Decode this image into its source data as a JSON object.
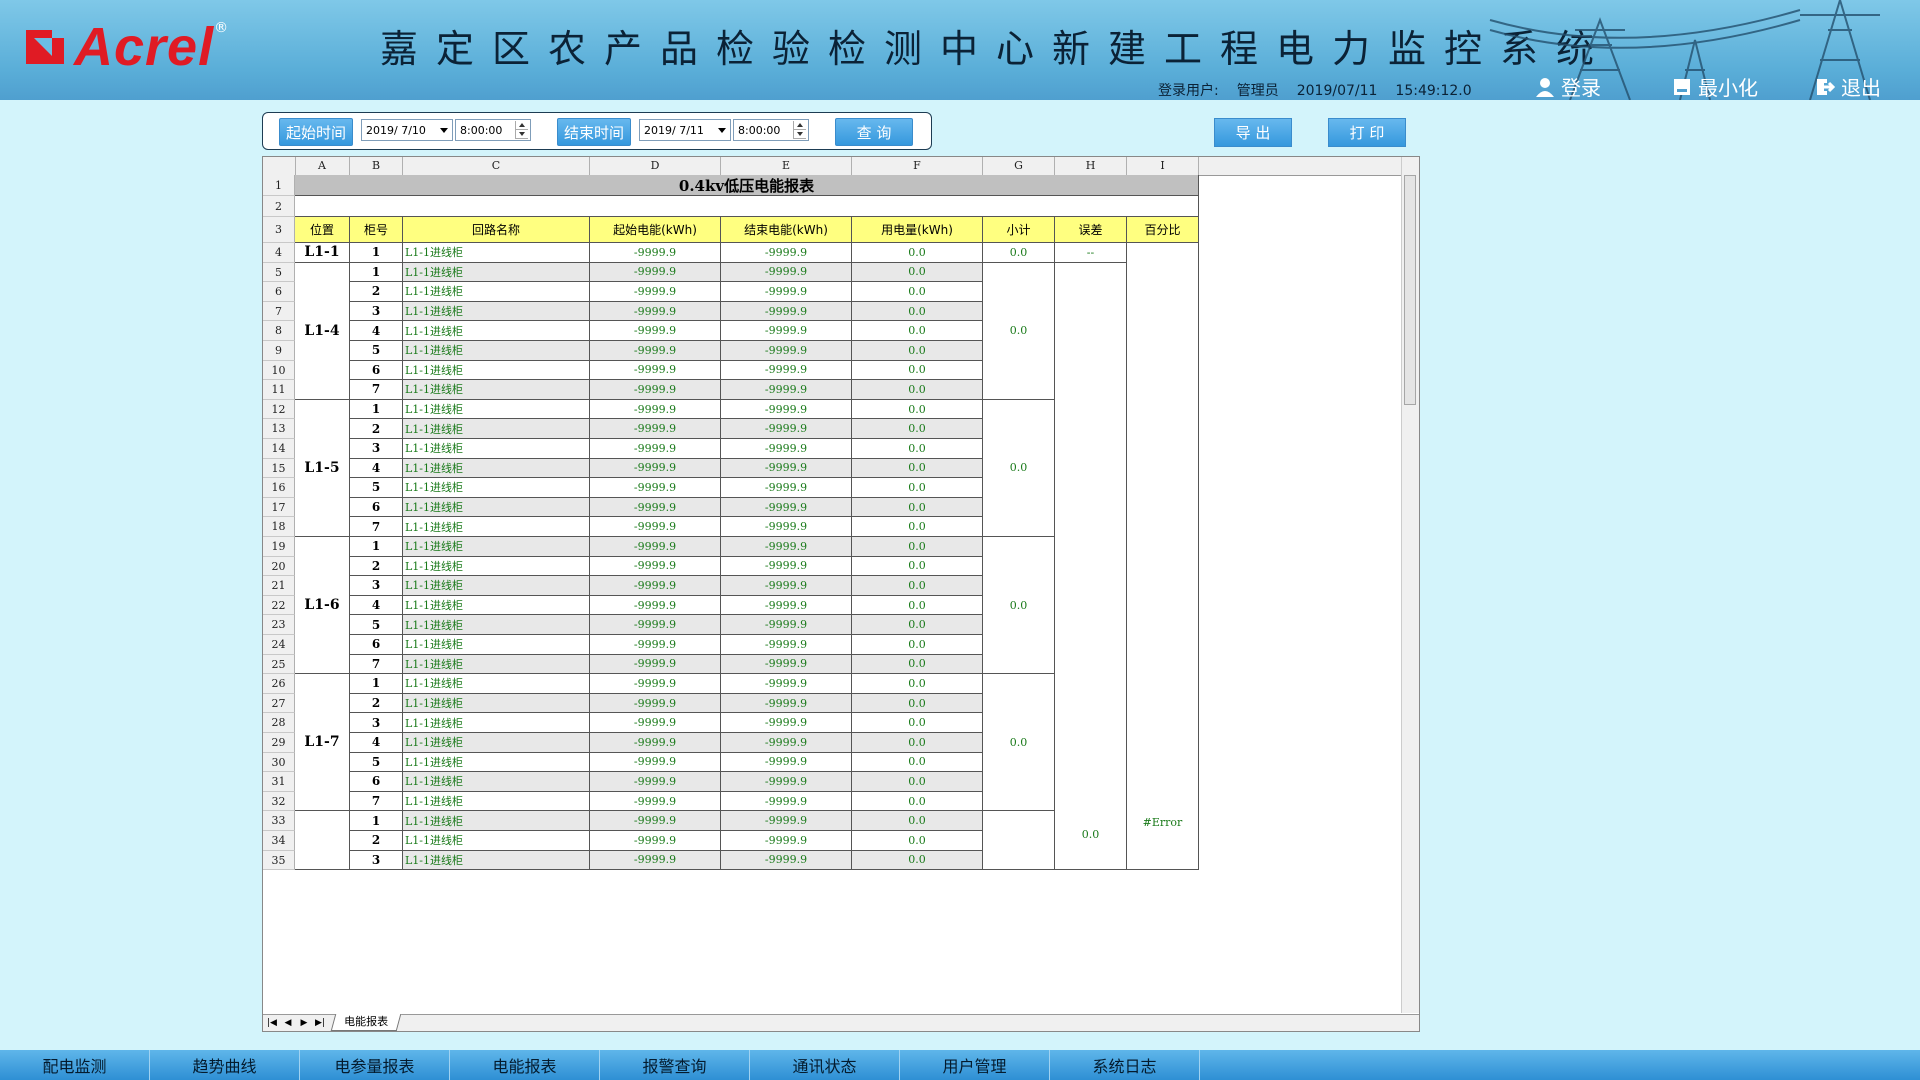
{
  "header": {
    "logo_text": "Acrel",
    "logo_reg": "®",
    "title": "嘉定区农产品检验检测中心新建工程电力监控系统",
    "login_label": "登录用户:",
    "user": "管理员",
    "date": "2019/07/11",
    "time": "15:49:12.0",
    "buttons": {
      "login": "登录",
      "minimize": "最小化",
      "exit": "退出"
    }
  },
  "toolbar": {
    "start_label": "起始时间",
    "start_date": "2019/ 7/10",
    "start_time": "8:00:00",
    "end_label": "结束时间",
    "end_date": "2019/ 7/11",
    "end_time": "8:00:00",
    "query": "查 询",
    "export": "导 出",
    "print": "打 印"
  },
  "sheet": {
    "columns": [
      "A",
      "B",
      "C",
      "D",
      "E",
      "F",
      "G",
      "H",
      "I"
    ],
    "title": "0.4kv低压电能报表",
    "headers": [
      "位置",
      "柜号",
      "回路名称",
      "起始电能(kWh)",
      "结束电能(kWh)",
      "用电量(kWh)",
      "小计",
      "误差",
      "百分比"
    ],
    "groups": [
      {
        "pos": "L1-1",
        "subtotal": "0.0",
        "rows": [
          {
            "no": "1",
            "name": "L1-1进线柜",
            "start": "-9999.9",
            "end": "-9999.9",
            "use": "0.0"
          }
        ]
      },
      {
        "pos": "L1-4",
        "subtotal": "0.0",
        "rows": [
          {
            "no": "1",
            "name": "L1-1进线柜",
            "start": "-9999.9",
            "end": "-9999.9",
            "use": "0.0"
          },
          {
            "no": "2",
            "name": "L1-1进线柜",
            "start": "-9999.9",
            "end": "-9999.9",
            "use": "0.0"
          },
          {
            "no": "3",
            "name": "L1-1进线柜",
            "start": "-9999.9",
            "end": "-9999.9",
            "use": "0.0"
          },
          {
            "no": "4",
            "name": "L1-1进线柜",
            "start": "-9999.9",
            "end": "-9999.9",
            "use": "0.0"
          },
          {
            "no": "5",
            "name": "L1-1进线柜",
            "start": "-9999.9",
            "end": "-9999.9",
            "use": "0.0"
          },
          {
            "no": "6",
            "name": "L1-1进线柜",
            "start": "-9999.9",
            "end": "-9999.9",
            "use": "0.0"
          },
          {
            "no": "7",
            "name": "L1-1进线柜",
            "start": "-9999.9",
            "end": "-9999.9",
            "use": "0.0"
          }
        ]
      },
      {
        "pos": "L1-5",
        "subtotal": "0.0",
        "rows": [
          {
            "no": "1",
            "name": "L1-1进线柜",
            "start": "-9999.9",
            "end": "-9999.9",
            "use": "0.0"
          },
          {
            "no": "2",
            "name": "L1-1进线柜",
            "start": "-9999.9",
            "end": "-9999.9",
            "use": "0.0"
          },
          {
            "no": "3",
            "name": "L1-1进线柜",
            "start": "-9999.9",
            "end": "-9999.9",
            "use": "0.0"
          },
          {
            "no": "4",
            "name": "L1-1进线柜",
            "start": "-9999.9",
            "end": "-9999.9",
            "use": "0.0"
          },
          {
            "no": "5",
            "name": "L1-1进线柜",
            "start": "-9999.9",
            "end": "-9999.9",
            "use": "0.0"
          },
          {
            "no": "6",
            "name": "L1-1进线柜",
            "start": "-9999.9",
            "end": "-9999.9",
            "use": "0.0"
          },
          {
            "no": "7",
            "name": "L1-1进线柜",
            "start": "-9999.9",
            "end": "-9999.9",
            "use": "0.0"
          }
        ]
      },
      {
        "pos": "L1-6",
        "subtotal": "0.0",
        "rows": [
          {
            "no": "1",
            "name": "L1-1进线柜",
            "start": "-9999.9",
            "end": "-9999.9",
            "use": "0.0"
          },
          {
            "no": "2",
            "name": "L1-1进线柜",
            "start": "-9999.9",
            "end": "-9999.9",
            "use": "0.0"
          },
          {
            "no": "3",
            "name": "L1-1进线柜",
            "start": "-9999.9",
            "end": "-9999.9",
            "use": "0.0"
          },
          {
            "no": "4",
            "name": "L1-1进线柜",
            "start": "-9999.9",
            "end": "-9999.9",
            "use": "0.0"
          },
          {
            "no": "5",
            "name": "L1-1进线柜",
            "start": "-9999.9",
            "end": "-9999.9",
            "use": "0.0"
          },
          {
            "no": "6",
            "name": "L1-1进线柜",
            "start": "-9999.9",
            "end": "-9999.9",
            "use": "0.0"
          },
          {
            "no": "7",
            "name": "L1-1进线柜",
            "start": "-9999.9",
            "end": "-9999.9",
            "use": "0.0"
          }
        ]
      },
      {
        "pos": "L1-7",
        "subtotal": "0.0",
        "rows": [
          {
            "no": "1",
            "name": "L1-1进线柜",
            "start": "-9999.9",
            "end": "-9999.9",
            "use": "0.0"
          },
          {
            "no": "2",
            "name": "L1-1进线柜",
            "start": "-9999.9",
            "end": "-9999.9",
            "use": "0.0"
          },
          {
            "no": "3",
            "name": "L1-1进线柜",
            "start": "-9999.9",
            "end": "-9999.9",
            "use": "0.0"
          },
          {
            "no": "4",
            "name": "L1-1进线柜",
            "start": "-9999.9",
            "end": "-9999.9",
            "use": "0.0"
          },
          {
            "no": "5",
            "name": "L1-1进线柜",
            "start": "-9999.9",
            "end": "-9999.9",
            "use": "0.0"
          },
          {
            "no": "6",
            "name": "L1-1进线柜",
            "start": "-9999.9",
            "end": "-9999.9",
            "use": "0.0"
          },
          {
            "no": "7",
            "name": "L1-1进线柜",
            "start": "-9999.9",
            "end": "-9999.9",
            "use": "0.0"
          }
        ]
      },
      {
        "pos": "",
        "subtotal": "",
        "rows": [
          {
            "no": "1",
            "name": "L1-1进线柜",
            "start": "-9999.9",
            "end": "-9999.9",
            "use": "0.0"
          },
          {
            "no": "2",
            "name": "L1-1进线柜",
            "start": "-9999.9",
            "end": "-9999.9",
            "use": "0.0"
          },
          {
            "no": "3",
            "name": "L1-1进线柜",
            "start": "-9999.9",
            "end": "-9999.9",
            "use": "0.0"
          }
        ]
      }
    ],
    "first_error": "--",
    "error_total": "0.0",
    "percent_value": "#Error",
    "tab_name": "电能报表"
  },
  "bottom_nav": [
    "配电监测",
    "趋势曲线",
    "电参量报表",
    "电能报表",
    "报警查询",
    "通讯状态",
    "用户管理",
    "系统日志"
  ],
  "colors": {
    "accent": "#3598dd",
    "header_yellow": "#ffff80",
    "value_green": "#1a7a1a"
  }
}
